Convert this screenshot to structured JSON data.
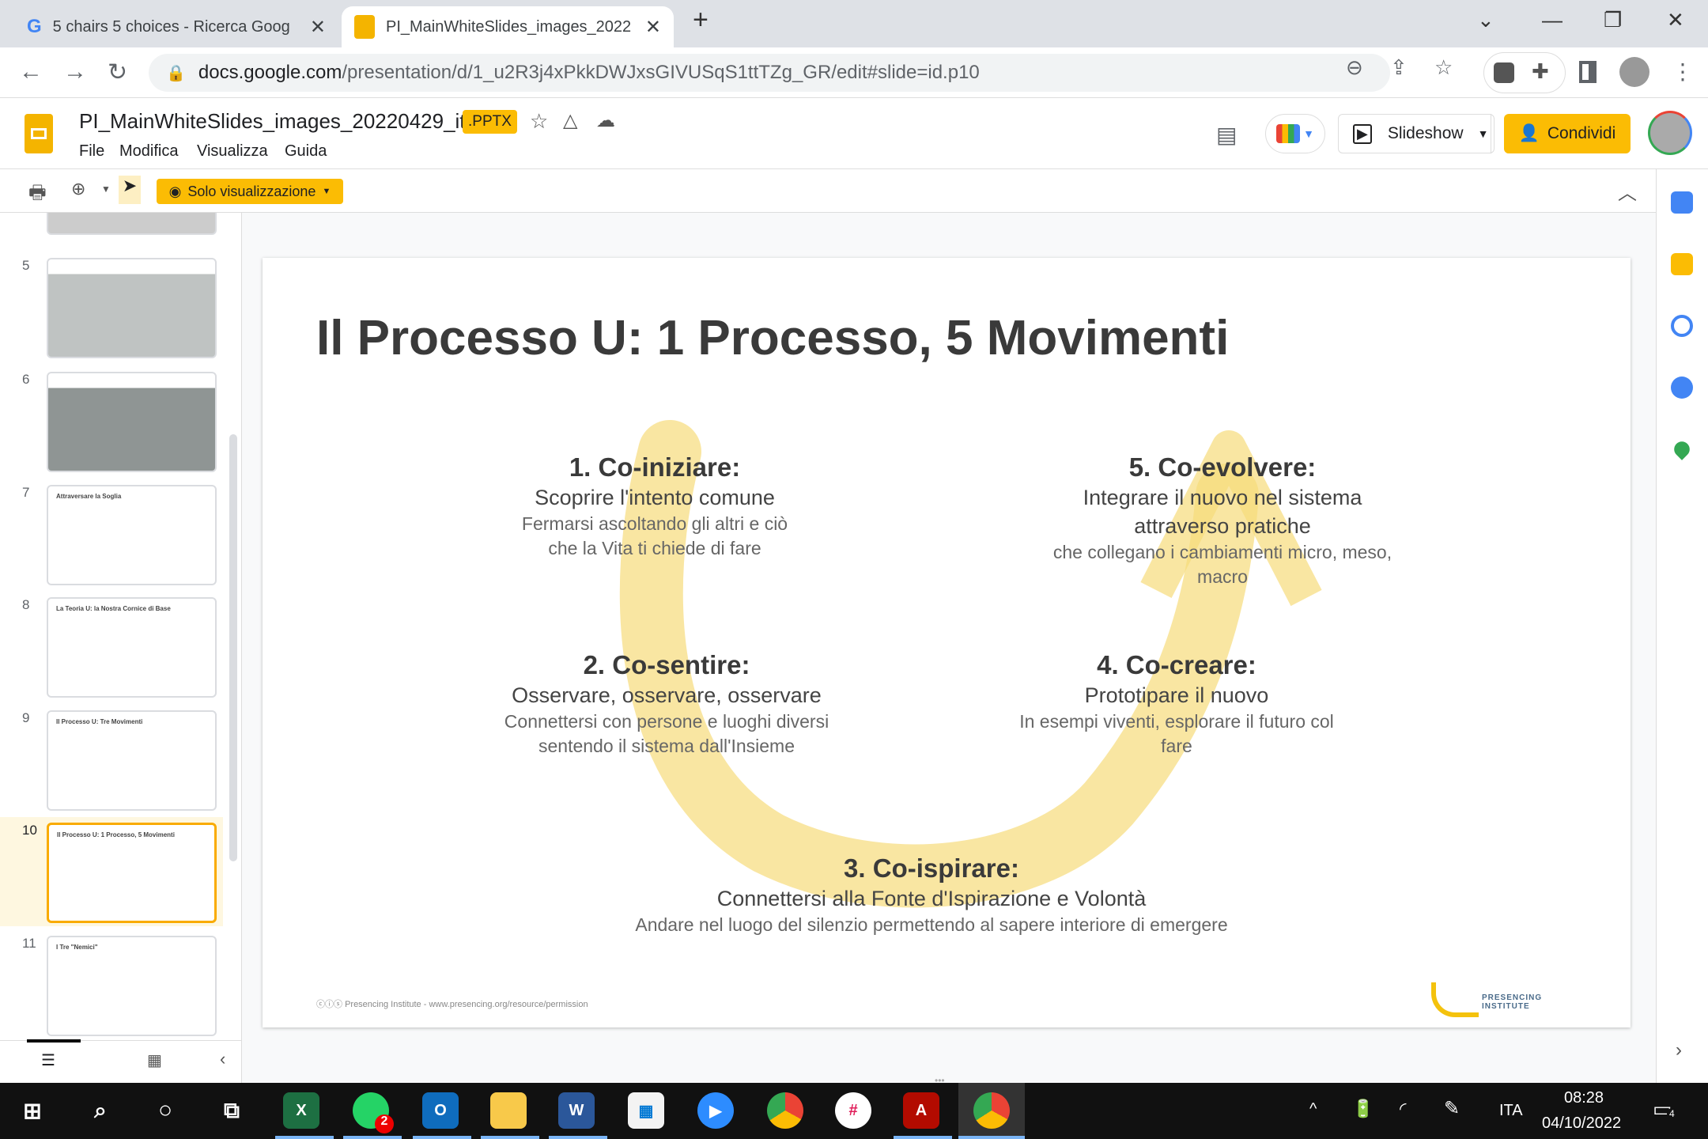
{
  "browser": {
    "tabs": [
      {
        "title": "5 chairs 5 choices - Ricerca Goog",
        "icon": "google-icon"
      },
      {
        "title": "PI_MainWhiteSlides_images_2022",
        "icon": "slides-icon",
        "active": true
      }
    ],
    "url_host": "docs.google.com",
    "url_path": "/presentation/d/1_u2R3j4xPkkDWJxsGIVUSqS1ttTZg_GR/edit#slide=id.p10"
  },
  "doc": {
    "title": "PI_MainWhiteSlides_images_20220429_it",
    "badge": ".PPTX",
    "menu": [
      "File",
      "Modifica",
      "Visualizza",
      "Guida"
    ],
    "slideshow_label": "Slideshow",
    "share_label": "Condividi",
    "view_mode_label": "Solo visualizzazione"
  },
  "filmstrip": {
    "selected": 10,
    "slides": [
      {
        "num": "5",
        "title": ""
      },
      {
        "num": "6",
        "title": ""
      },
      {
        "num": "7",
        "title": "Attraversare la Soglia"
      },
      {
        "num": "8",
        "title": "La Teoria U: la Nostra Cornice di Base"
      },
      {
        "num": "9",
        "title": "Il Processo U: Tre Movimenti"
      },
      {
        "num": "10",
        "title": "Il Processo U: 1 Processo, 5 Movimenti"
      },
      {
        "num": "11",
        "title": "I Tre \"Nemici\""
      }
    ]
  },
  "slide": {
    "title": "Il Processo U: 1 Processo, 5 Movimenti",
    "sections": [
      {
        "heading": "1. Co-iniziare:",
        "line2": "Scoprire l'intento comune",
        "line3": "Fermarsi ascoltando gli altri e ciò che la Vita ti chiede di fare"
      },
      {
        "heading": "5. Co-evolvere:",
        "line2": "Integrare il nuovo nel sistema attraverso pratiche",
        "line3": "che collegano i cambiamenti micro, meso, macro"
      },
      {
        "heading": "2. Co-sentire:",
        "line2": "Osservare, osservare, osservare",
        "line3": "Connettersi con persone e luoghi diversi sentendo il sistema dall'Insieme"
      },
      {
        "heading": "4. Co-creare:",
        "line2": "Prototipare il nuovo",
        "line3": "In esempi viventi, esplorare il futuro col fare"
      },
      {
        "heading": "3. Co-ispirare:",
        "line2": "Connettersi alla Fonte d'Ispirazione e Volontà",
        "line3": "Andare nel luogo del silenzio permettendo al sapere interiore di emergere"
      }
    ],
    "footer": "Presencing Institute - www.presencing.org/resource/permission",
    "logo_text": "PRESENCING INSTITUTE",
    "accent_color": "#f7dc7a"
  },
  "taskbar": {
    "whatsapp_badge": "2",
    "language": "ITA",
    "time": "08:28",
    "date": "04/10/2022",
    "notifications": "4"
  }
}
